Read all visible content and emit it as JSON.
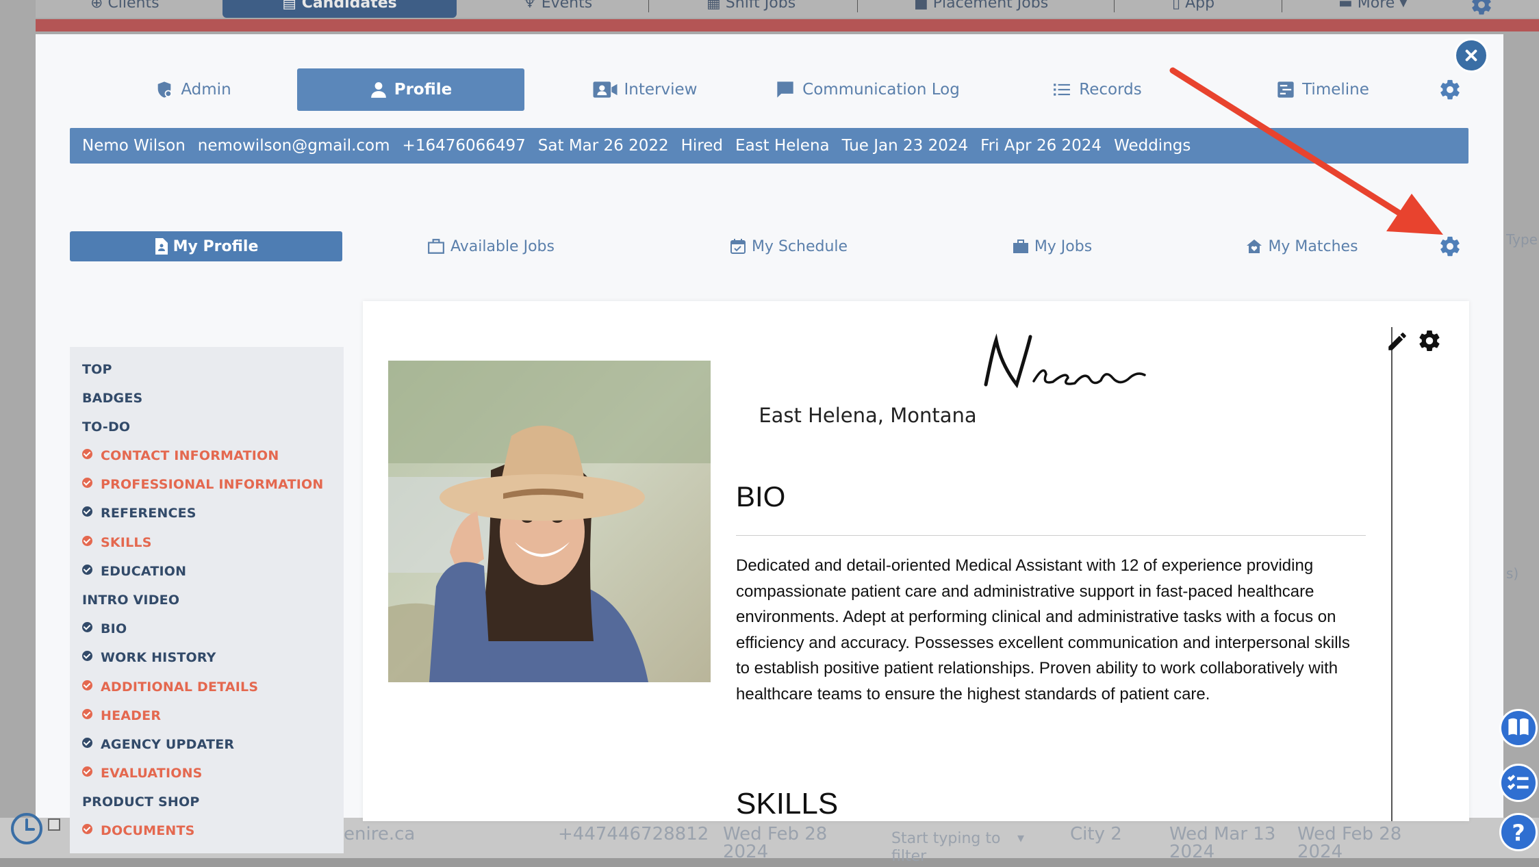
{
  "background": {
    "nav": [
      {
        "label": "Clients",
        "active": false
      },
      {
        "label": "Candidates",
        "active": true
      },
      {
        "label": "Events",
        "active": false
      },
      {
        "label": "Shift Jobs",
        "active": false
      },
      {
        "label": "Placement Jobs",
        "active": false
      },
      {
        "label": "App",
        "active": false
      },
      {
        "label": "More",
        "active": false
      }
    ],
    "row": {
      "email": "enire.ca",
      "phone": "+447446728812",
      "date1": "Wed Feb 28",
      "date1_year": "2024",
      "filter_placeholder": "Start typing to",
      "filter_placeholder2": "filter",
      "city": "City 2",
      "date2": "Wed Mar 13",
      "date2_year": "2024",
      "date3": "Wed Feb 28",
      "date3_year": "2024"
    },
    "side_fragments": [
      "Type",
      "s)"
    ]
  },
  "tabs": [
    {
      "label": "Admin",
      "icon": "shield-icon",
      "active": false
    },
    {
      "label": "Profile",
      "icon": "user-icon",
      "active": true
    },
    {
      "label": "Interview",
      "icon": "video-call-icon",
      "active": false
    },
    {
      "label": "Communication Log",
      "icon": "chat-icon",
      "active": false
    },
    {
      "label": "Records",
      "icon": "list-icon",
      "active": false
    },
    {
      "label": "Timeline",
      "icon": "timeline-icon",
      "active": false
    }
  ],
  "info_bar": {
    "name": "Nemo Wilson",
    "email": "nemowilson@gmail.com",
    "phone": "+16476066497",
    "date_created": "Sat Mar 26 2022",
    "status": "Hired",
    "city": "East Helena",
    "date_updated": "Tue Jan 23 2024",
    "date_next": "Fri Apr 26 2024",
    "category": "Weddings"
  },
  "subtabs": [
    {
      "label": "My Profile",
      "icon": "document-icon",
      "active": true
    },
    {
      "label": "Available Jobs",
      "icon": "briefcase-outline-icon",
      "active": false
    },
    {
      "label": "My Schedule",
      "icon": "calendar-check-icon",
      "active": false
    },
    {
      "label": "My Jobs",
      "icon": "briefcase-icon",
      "active": false
    },
    {
      "label": "My Matches",
      "icon": "home-heart-icon",
      "active": false
    }
  ],
  "side_menu": [
    {
      "label": "TOP",
      "type": "head"
    },
    {
      "label": "BADGES",
      "type": "head"
    },
    {
      "label": "TO-DO",
      "type": "head"
    },
    {
      "label": "CONTACT INFORMATION",
      "type": "bad"
    },
    {
      "label": "PROFESSIONAL INFORMATION",
      "type": "bad"
    },
    {
      "label": "REFERENCES",
      "type": "ok"
    },
    {
      "label": "SKILLS",
      "type": "bad"
    },
    {
      "label": "EDUCATION",
      "type": "ok"
    },
    {
      "label": "INTRO VIDEO",
      "type": "head"
    },
    {
      "label": "BIO",
      "type": "ok"
    },
    {
      "label": "WORK HISTORY",
      "type": "ok"
    },
    {
      "label": "ADDITIONAL DETAILS",
      "type": "bad"
    },
    {
      "label": "HEADER",
      "type": "bad"
    },
    {
      "label": "AGENCY UPDATER",
      "type": "ok"
    },
    {
      "label": "EVALUATIONS",
      "type": "bad"
    },
    {
      "label": "PRODUCT SHOP",
      "type": "head"
    },
    {
      "label": "DOCUMENTS",
      "type": "bad"
    }
  ],
  "profile": {
    "signature_name": "Nemo",
    "location": "East Helena, Montana",
    "bio_title": "BIO",
    "bio_text": "Dedicated and detail-oriented Medical Assistant with 12 of experience providing compassionate patient care and administrative support in fast-paced healthcare environments. Adept at performing clinical and administrative tasks with a focus on efficiency and accuracy. Possesses excellent communication and interpersonal skills to establish positive patient relationships. Proven ability to work collaboratively with healthcare teams to ensure the highest standards of patient care.",
    "skills_title": "SKILLS"
  },
  "colors": {
    "accent": "#5b87ba",
    "dark_navy": "#324a69",
    "warning": "#e4684f",
    "annotation_arrow": "#e8432e"
  }
}
